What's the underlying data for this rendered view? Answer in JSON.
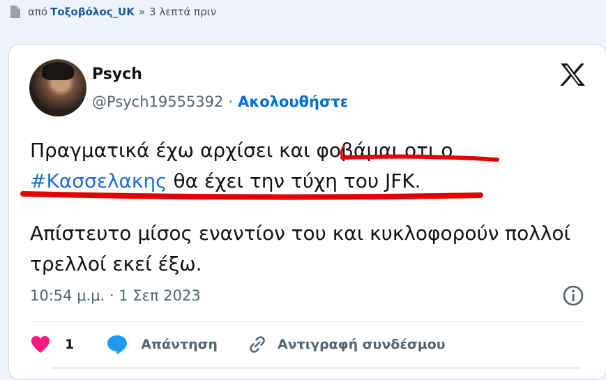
{
  "post_meta": {
    "prefix": "από",
    "author": "Τοξοβόλος_UK",
    "separator": "»",
    "time_ago": "3 λεπτά πριν"
  },
  "tweet": {
    "display_name": "Psych",
    "handle": "@Psych19555392",
    "dot": "·",
    "follow_label": "Ακολουθήστε",
    "line1": "Πραγματικά έχω αρχίσει και φοβάμαι οτι ο",
    "hashtag": "#Κασσελακης",
    "line2_rest": " θα έχει την τύχη του JFK.",
    "paragraph2": "Απίστευτο μίσος εναντίον του και κυκλοφορούν πολλοί τρελλοί εκεί έξω.",
    "timestamp": "10:54 μ.μ. · 1 Σεπ 2023",
    "like_count": "1",
    "reply_label": "Απάντηση",
    "copy_link_label": "Αντιγραφή συνδέσμου"
  },
  "colors": {
    "link_blue": "#006fd6",
    "like_pink": "#f91880",
    "reply_blue": "#1d9bf0",
    "annotation_red": "#e50000"
  },
  "icons": [
    "document-icon",
    "x-logo-icon",
    "info-icon",
    "heart-icon",
    "reply-bubble-icon",
    "link-icon"
  ]
}
